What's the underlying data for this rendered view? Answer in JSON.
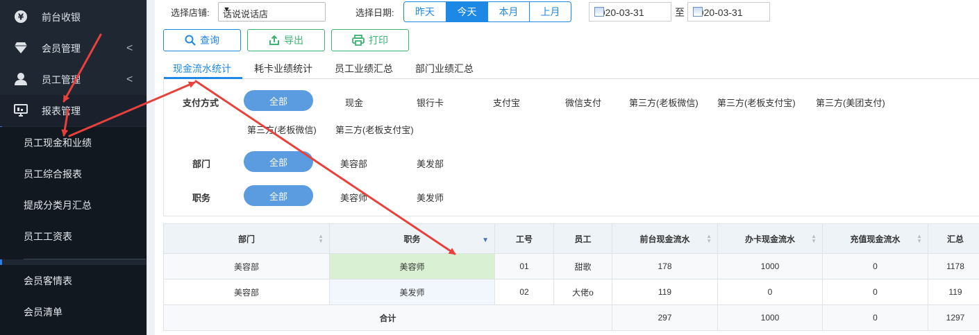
{
  "sidebar": {
    "items": [
      {
        "label": "前台收银"
      },
      {
        "label": "会员管理"
      },
      {
        "label": "员工管理"
      },
      {
        "label": "报表管理"
      }
    ],
    "submenu": [
      {
        "label": "员工现金和业绩"
      },
      {
        "label": "员工综合报表"
      },
      {
        "label": "提成分类月汇总"
      },
      {
        "label": "员工工资表"
      },
      {
        "label": "会员客情表"
      },
      {
        "label": "会员清单"
      }
    ],
    "chevron": "<"
  },
  "toolbar": {
    "store_label": "选择店铺:",
    "store_value": "话说说话店",
    "date_label": "选择日期:",
    "date_ranges": [
      "昨天",
      "今天",
      "本月",
      "上月"
    ],
    "date_from": "2020-03-31",
    "to_label": "至",
    "date_to": "2020-03-31",
    "query_label": "查询",
    "export_label": "导出",
    "print_label": "打印"
  },
  "tabs": [
    "现金流水统计",
    "耗卡业绩统计",
    "员工业绩汇总",
    "部门业绩汇总"
  ],
  "filters": {
    "payment": {
      "label": "支付方式",
      "selected": "全部",
      "options": [
        "现金",
        "银行卡",
        "支付宝",
        "微信支付",
        "第三方(老板微信)",
        "第三方(老板支付宝)",
        "第三方(美团支付)",
        "第三方(老板微信)",
        "第三方(老板支付宝)"
      ]
    },
    "department": {
      "label": "部门",
      "selected": "全部",
      "options": [
        "美容部",
        "美发部"
      ]
    },
    "position": {
      "label": "职务",
      "selected": "全部",
      "options": [
        "美容师",
        "美发师"
      ]
    }
  },
  "table": {
    "headers": [
      "部门",
      "职务",
      "工号",
      "员工",
      "前台现金流水",
      "办卡现金流水",
      "充值现金流水",
      "汇总"
    ],
    "rows": [
      [
        "美容部",
        "美容师",
        "01",
        "甜歌",
        "178",
        "1000",
        "0",
        "1178"
      ],
      [
        "美容部",
        "美发师",
        "02",
        "大佬o",
        "119",
        "0",
        "0",
        "119"
      ]
    ],
    "total": {
      "label": "合计",
      "values": [
        "297",
        "1000",
        "0",
        "1297"
      ]
    }
  },
  "colors": {
    "accent": "#1e88e5",
    "green": "#3cb371",
    "pill": "#5b9be0",
    "sidebar": "#1f2733",
    "annotation": "#e8413b"
  },
  "icons": {
    "currency": "yen-icon",
    "member": "diamond-icon",
    "staff": "user-icon",
    "report": "monitor-icon"
  }
}
